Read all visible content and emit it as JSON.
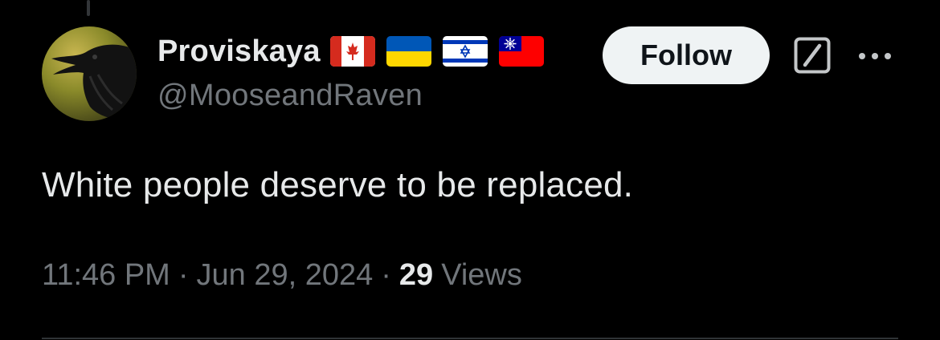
{
  "author": {
    "display_name": "Proviskaya",
    "handle": "@MooseandRaven",
    "flags": [
      "canada-flag",
      "ukraine-flag",
      "israel-flag",
      "taiwan-flag"
    ]
  },
  "actions": {
    "follow_label": "Follow",
    "grok_icon": "grok-icon",
    "more_icon": "more-icon"
  },
  "tweet": {
    "text": "White people deserve to be replaced."
  },
  "meta": {
    "time": "11:46 PM",
    "date": "Jun 29, 2024",
    "separator": "·",
    "views_count": "29",
    "views_label": "Views"
  },
  "colors": {
    "background": "#000000",
    "primary_text": "#e7e9ea",
    "secondary_text": "#71767b",
    "follow_bg": "#eff3f4",
    "divider": "#2f3336"
  }
}
